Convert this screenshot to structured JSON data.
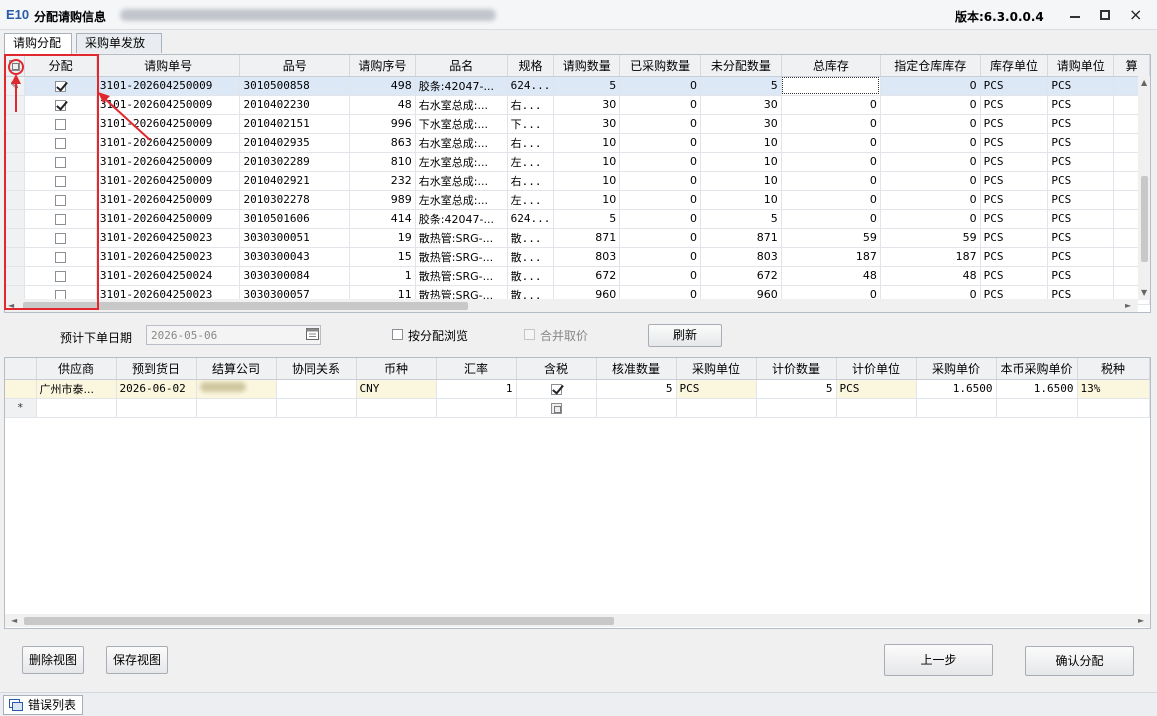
{
  "window": {
    "logo": "E10",
    "title": "分配请购信息",
    "version": "版本:6.3.0.0.4",
    "min": "−",
    "max": "□",
    "close": "×"
  },
  "tabs": [
    {
      "label": "请购分配",
      "active": true
    },
    {
      "label": "采购单发放",
      "active": false
    }
  ],
  "top_grid": {
    "columns": [
      "",
      "分配",
      "请购单号",
      "品号",
      "请购序号",
      "品名",
      "规格",
      "请购数量",
      "已采购数量",
      "未分配数量",
      "总库存",
      "指定仓库库存",
      "库存单位",
      "请购单位",
      "算"
    ],
    "rows": [
      {
        "ind": "✎",
        "checked": true,
        "req_no": "3101-202604250009",
        "item_no": "3010500858",
        "seq": "498",
        "name": "胶条:42047-...",
        "spec": "624...",
        "qty": "5",
        "purchased": "0",
        "unalloc": "5",
        "stock": "",
        "wh_stock": "0",
        "stock_unit": "PCS",
        "req_unit": "PCS"
      },
      {
        "ind": "",
        "checked": true,
        "req_no": "3101-202604250009",
        "item_no": "2010402230",
        "seq": "48",
        "name": "右水室总成:...",
        "spec": "右...",
        "qty": "30",
        "purchased": "0",
        "unalloc": "30",
        "stock": "0",
        "wh_stock": "0",
        "stock_unit": "PCS",
        "req_unit": "PCS"
      },
      {
        "ind": "",
        "checked": false,
        "req_no": "3101-202604250009",
        "item_no": "2010402151",
        "seq": "996",
        "name": "下水室总成:...",
        "spec": "下...",
        "qty": "30",
        "purchased": "0",
        "unalloc": "30",
        "stock": "0",
        "wh_stock": "0",
        "stock_unit": "PCS",
        "req_unit": "PCS"
      },
      {
        "ind": "",
        "checked": false,
        "req_no": "3101-202604250009",
        "item_no": "2010402935",
        "seq": "863",
        "name": "右水室总成:...",
        "spec": "右...",
        "qty": "10",
        "purchased": "0",
        "unalloc": "10",
        "stock": "0",
        "wh_stock": "0",
        "stock_unit": "PCS",
        "req_unit": "PCS"
      },
      {
        "ind": "",
        "checked": false,
        "req_no": "3101-202604250009",
        "item_no": "2010302289",
        "seq": "810",
        "name": "左水室总成:...",
        "spec": "左...",
        "qty": "10",
        "purchased": "0",
        "unalloc": "10",
        "stock": "0",
        "wh_stock": "0",
        "stock_unit": "PCS",
        "req_unit": "PCS"
      },
      {
        "ind": "",
        "checked": false,
        "req_no": "3101-202604250009",
        "item_no": "2010402921",
        "seq": "232",
        "name": "右水室总成:...",
        "spec": "右...",
        "qty": "10",
        "purchased": "0",
        "unalloc": "10",
        "stock": "0",
        "wh_stock": "0",
        "stock_unit": "PCS",
        "req_unit": "PCS"
      },
      {
        "ind": "",
        "checked": false,
        "req_no": "3101-202604250009",
        "item_no": "2010302278",
        "seq": "989",
        "name": "左水室总成:...",
        "spec": "左...",
        "qty": "10",
        "purchased": "0",
        "unalloc": "10",
        "stock": "0",
        "wh_stock": "0",
        "stock_unit": "PCS",
        "req_unit": "PCS"
      },
      {
        "ind": "",
        "checked": false,
        "req_no": "3101-202604250009",
        "item_no": "3010501606",
        "seq": "414",
        "name": "胶条:42047-...",
        "spec": "624...",
        "qty": "5",
        "purchased": "0",
        "unalloc": "5",
        "stock": "0",
        "wh_stock": "0",
        "stock_unit": "PCS",
        "req_unit": "PCS"
      },
      {
        "ind": "",
        "checked": false,
        "req_no": "3101-202604250023",
        "item_no": "3030300051",
        "seq": "19",
        "name": "散热管:SRG-...",
        "spec": "散...",
        "qty": "871",
        "purchased": "0",
        "unalloc": "871",
        "stock": "59",
        "wh_stock": "59",
        "stock_unit": "PCS",
        "req_unit": "PCS"
      },
      {
        "ind": "",
        "checked": false,
        "req_no": "3101-202604250023",
        "item_no": "3030300043",
        "seq": "15",
        "name": "散热管:SRG-...",
        "spec": "散...",
        "qty": "803",
        "purchased": "0",
        "unalloc": "803",
        "stock": "187",
        "wh_stock": "187",
        "stock_unit": "PCS",
        "req_unit": "PCS"
      },
      {
        "ind": "",
        "checked": false,
        "req_no": "3101-202604250024",
        "item_no": "3030300084",
        "seq": "1",
        "name": "散热管:SRG-...",
        "spec": "散...",
        "qty": "672",
        "purchased": "0",
        "unalloc": "672",
        "stock": "48",
        "wh_stock": "48",
        "stock_unit": "PCS",
        "req_unit": "PCS"
      },
      {
        "ind": "",
        "checked": false,
        "req_no": "3101-202604250023",
        "item_no": "3030300057",
        "seq": "11",
        "name": "散热管:SRG-...",
        "spec": "散...",
        "qty": "960",
        "purchased": "0",
        "unalloc": "960",
        "stock": "0",
        "wh_stock": "0",
        "stock_unit": "PCS",
        "req_unit": "PCS"
      }
    ]
  },
  "filter": {
    "date_label": "预计下单日期",
    "date_value": "2026-05-06",
    "browse_label": "按分配浏览",
    "merge_label": "合并取价",
    "refresh_label": "刷新"
  },
  "bottom_grid": {
    "columns": [
      "",
      "供应商",
      "预到货日",
      "结算公司",
      "协同关系",
      "币种",
      "汇率",
      "含税",
      "核准数量",
      "采购单位",
      "计价数量",
      "计价单位",
      "采购单价",
      "本币采购单价",
      "税种"
    ],
    "rows": [
      {
        "ind": "",
        "supplier": "广州市泰...",
        "arrival": "2026-06-02",
        "company": "",
        "relation": "",
        "currency": "CNY",
        "rate": "1",
        "tax_incl": true,
        "approved_qty": "5",
        "po_unit": "PCS",
        "price_qty": "5",
        "price_unit": "PCS",
        "unit_price": "1.6500",
        "local_price": "1.6500",
        "tax": "13%"
      }
    ],
    "new_row_marker": "*"
  },
  "buttons": {
    "delete_view": "删除视图",
    "save_view": "保存视图",
    "prev_step": "上一步",
    "confirm": "确认分配"
  },
  "statusbar": {
    "error_tab": "错误列表"
  },
  "colors": {
    "annotation": "#e0282e",
    "selected_row": "#dde8f7",
    "edit_row": "#fbf7de"
  }
}
